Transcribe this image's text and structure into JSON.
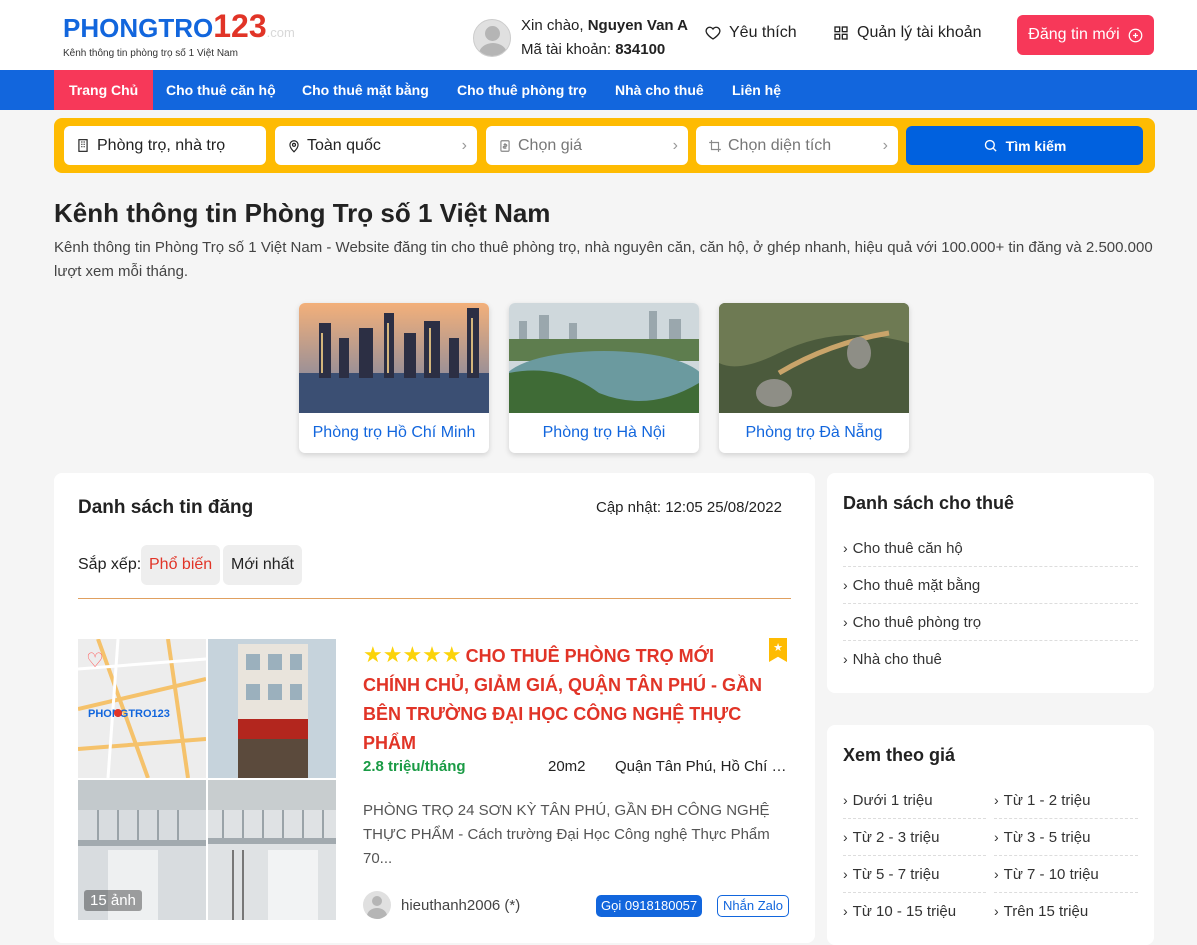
{
  "header": {
    "logo_main_1": "PHONGTRO",
    "logo_main_2": "123",
    "logo_domain": ".com",
    "logo_tagline": "Kênh thông tin phòng trọ số 1 Việt Nam",
    "greeting_prefix": "Xin chào, ",
    "user_name": "Nguyen Van A",
    "account_label": "Mã tài khoản: ",
    "account_id": "834100",
    "favorites": "Yêu thích",
    "manage_account": "Quản lý tài khoản",
    "post_new": "Đăng tin mới",
    "accent": "#f73859"
  },
  "nav": {
    "items": [
      "Trang Chủ",
      "Cho thuê căn hộ",
      "Cho thuê mặt bằng",
      "Cho thuê phòng trọ",
      "Nhà cho thuê",
      "Liên hệ"
    ],
    "bg": "#1266dd"
  },
  "search": {
    "type": "Phòng trọ, nhà trọ",
    "location": "Toàn quốc",
    "price_placeholder": "Chọn giá",
    "area_placeholder": "Chọn diện tích",
    "button": "Tìm kiếm",
    "bg": "#febb02"
  },
  "intro": {
    "title": "Kênh thông tin Phòng Trọ số 1 Việt Nam",
    "text": "Kênh thông tin Phòng Trọ số 1 Việt Nam - Website đăng tin cho thuê phòng trọ, nhà nguyên căn, căn hộ, ở ghép nhanh, hiệu quả với 100.000+ tin đăng và 2.500.000 lượt xem mỗi tháng."
  },
  "cities": [
    "Phòng trọ Hồ Chí Minh",
    "Phòng trọ Hà Nội",
    "Phòng trọ Đà Nẵng"
  ],
  "listing": {
    "title": "Danh sách tin đăng",
    "updated": "Cập nhật: 12:05 25/08/2022",
    "sort_label": "Sắp xếp:",
    "sort_popular": "Phổ biến",
    "sort_newest": "Mới nhất",
    "post": {
      "stars": "★★★★★",
      "title": "CHO THUÊ PHÒNG TRỌ MỚI CHÍNH CHỦ, GIẢM GIÁ, QUẬN TÂN PHÚ - GẦN BÊN TRƯỜNG ĐẠI HỌC CÔNG NGHỆ THỰC PHẨM",
      "price": "2.8 triệu/tháng",
      "area": "20m2",
      "location": "Quận Tân Phú, Hồ Chí Minh",
      "description": "PHÒNG TRỌ 24 SƠN KỲ TÂN PHÚ, GẦN ĐH CÔNG NGHỆ THỰC PHẨM - Cách trường Đại Học Công nghệ Thực Phẩm 70...",
      "photo_count": "15 ảnh",
      "author": "hieuthanh2006 (*)",
      "call": "Gọi 0918180057",
      "zalo": "Nhắn Zalo"
    }
  },
  "sidebar": {
    "rent_title": "Danh sách cho thuê",
    "rent_items": [
      "Cho thuê căn hộ",
      "Cho thuê mặt bằng",
      "Cho thuê phòng trọ",
      "Nhà cho thuê"
    ],
    "price_title": "Xem theo giá",
    "price_items": [
      "Dưới 1 triệu",
      "Từ 1 - 2 triệu",
      "Từ 2 - 3 triệu",
      "Từ 3 - 5 triệu",
      "Từ 5 - 7 triệu",
      "Từ 7 - 10 triệu",
      "Từ 10 - 15 triệu",
      "Trên 15 triệu"
    ]
  }
}
